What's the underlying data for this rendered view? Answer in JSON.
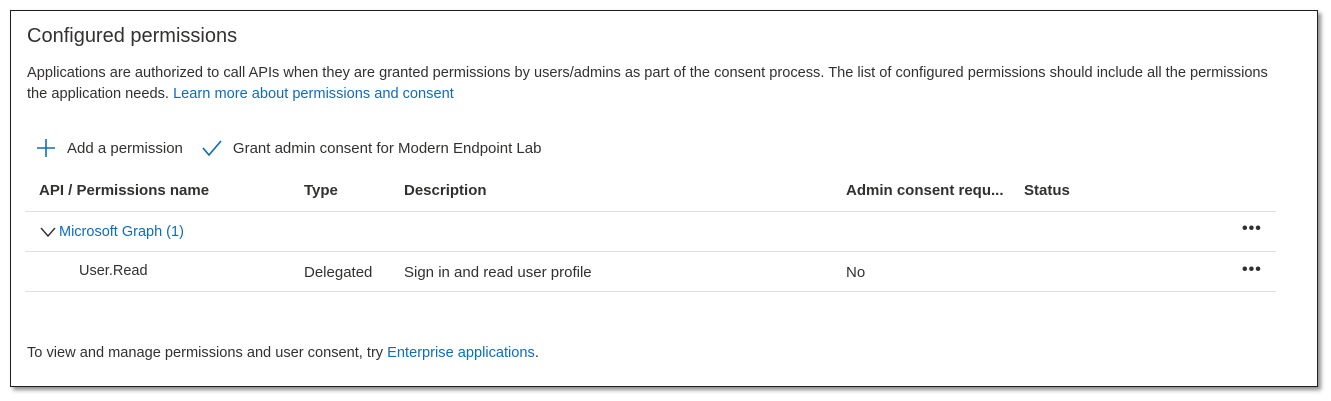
{
  "section": {
    "title": "Configured permissions",
    "description": "Applications are authorized to call APIs when they are granted permissions by users/admins as part of the consent process. The list of configured permissions should include all the permissions the application needs.",
    "learn_more_link": "Learn more about permissions and consent"
  },
  "toolbar": {
    "add_permission": "Add a permission",
    "grant_consent": "Grant admin consent for Modern Endpoint Lab"
  },
  "table": {
    "headers": {
      "api_name": "API / Permissions name",
      "type": "Type",
      "description": "Description",
      "admin_consent": "Admin consent requ...",
      "status": "Status"
    },
    "group": {
      "label": "Microsoft Graph (1)",
      "more": "•••"
    },
    "rows": [
      {
        "name": "User.Read",
        "type": "Delegated",
        "description": "Sign in and read user profile",
        "admin_consent": "No",
        "status": "",
        "more": "•••"
      }
    ]
  },
  "footer": {
    "text": "To view and manage permissions and user consent, try",
    "link": "Enterprise applications",
    "suffix": "."
  },
  "colors": {
    "link": "#0f6cbd",
    "text": "#323130",
    "divider": "#e1dfdd"
  },
  "icons": {
    "add": "plus-icon",
    "grant": "checkmark-icon",
    "group_toggle": "chevron-down-icon",
    "more": "more-actions-icon"
  }
}
